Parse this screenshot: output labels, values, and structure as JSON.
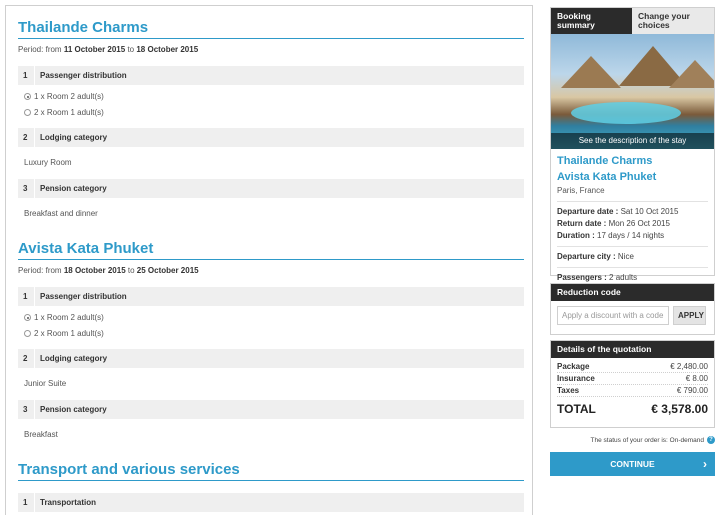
{
  "main": {
    "trips": [
      {
        "title": "Thailande Charms",
        "period_prefix": "Period:",
        "from_word": "from",
        "start": "11 October 2015",
        "to_word": "to",
        "end": "18 October 2015",
        "steps": [
          {
            "num": "1",
            "label": "Passenger distribution"
          },
          {
            "num": "2",
            "label": "Lodging category"
          },
          {
            "num": "3",
            "label": "Pension category"
          }
        ],
        "rooms": [
          "1 x Room 2 adult(s)",
          "2 x Room 1 adult(s)"
        ],
        "lodging": "Luxury Room",
        "pension": "Breakfast and dinner"
      },
      {
        "title": "Avista Kata Phuket",
        "period_prefix": "Period:",
        "from_word": "from",
        "start": "18 October 2015",
        "to_word": "to",
        "end": "25 October 2015",
        "steps": [
          {
            "num": "1",
            "label": "Passenger distribution"
          },
          {
            "num": "2",
            "label": "Lodging category"
          },
          {
            "num": "3",
            "label": "Pension category"
          }
        ],
        "rooms": [
          "1 x Room 2 adult(s)",
          "2 x Room 1 adult(s)"
        ],
        "lodging": "Junior Suite",
        "pension": "Breakfast"
      }
    ],
    "transport": {
      "title": "Transport and various services",
      "step_num": "1",
      "step_label": "Transportation"
    }
  },
  "sidebar": {
    "tabs": [
      "Booking summary",
      "Change your choices"
    ],
    "photo_caption": "See the description of the stay",
    "trip_name": "Thailande Charms",
    "hotel_name": "Avista Kata Phuket",
    "location": "Paris, France",
    "departure_label": "Departure date :",
    "departure_value": "Sat 10 Oct 2015",
    "return_label": "Return date :",
    "return_value": "Mon 26 Oct 2015",
    "duration_label": "Duration :",
    "duration_value": "17 days / 14 nights",
    "city_label": "Departure city :",
    "city_value": "Nice",
    "passengers_label": "Passengers :",
    "passengers_value": "2 adults"
  },
  "reduction": {
    "title": "Reduction code",
    "placeholder": "Apply a discount with a code",
    "apply": "APPLY"
  },
  "quote": {
    "title": "Details of the quotation",
    "rows": [
      {
        "label": "Package",
        "value": "€ 2,480.00"
      },
      {
        "label": "Insurance",
        "value": "€ 8.00"
      },
      {
        "label": "Taxes",
        "value": "€ 790.00"
      }
    ],
    "total_label": "TOTAL",
    "total_value": "€ 3,578.00"
  },
  "status_text": "The status of your order is: On-demand",
  "continue_label": "CONTINUE",
  "colors": {
    "accent": "#2e9ac9",
    "dark": "#2b2b2b",
    "step_bg": "#efefef"
  }
}
